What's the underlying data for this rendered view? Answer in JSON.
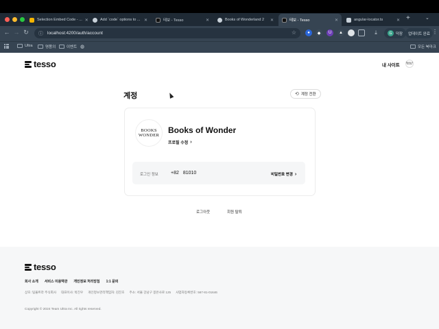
{
  "browser": {
    "tabs": [
      {
        "title": "Selection Embed Code - ..."
      },
      {
        "title": "Add `code` options to ..."
      },
      {
        "title": "테보 - Tesso"
      },
      {
        "title": "Books of Wonderland 2"
      },
      {
        "title": "테보 - Tesso"
      },
      {
        "title": "angular-locator.ts"
      }
    ],
    "active_tab": 4,
    "url": "localhost:4200/auth/account",
    "profile_label": "덕장",
    "update_label": "업데이트 완료",
    "bookmarks": [
      "Ultra",
      "명품의",
      "이벤트"
    ],
    "all_bookmarks": "모든 북마크",
    "colors": {
      "tabstrip": "#1f2a35",
      "toolbar": "#364452"
    }
  },
  "site": {
    "logo_text": "tesso",
    "header": {
      "my_sites": "내 사이트",
      "avatar_text": "Books of Wonder"
    },
    "account": {
      "title": "계정",
      "switch_label": "계정 전환",
      "site_logo_line1": "BOOKS",
      "site_logo_line2": "WONDER",
      "site_name": "Books of Wonder",
      "edit_profile": "프로필 수정",
      "login_label": "로그인 정보",
      "phone_code": "+82",
      "phone_number": "81010",
      "change_password": "비밀번호 변경"
    },
    "actions": {
      "logout": "로그아웃",
      "withdraw": "회원 탈퇴"
    },
    "footer": {
      "links": [
        "회사 소개",
        "서비스 이용약관",
        "개인정보 처리방침",
        "1:1 문의"
      ],
      "info": [
        "상호: 팀울트라 주식회사",
        "대표이사: 박진우",
        "개인정보관리책임자: 김진호",
        "주소: 서울 강남구 봉은사로 125",
        "사업자등록번호: 567-81-01646"
      ],
      "copyright": "Copyright © 2024 Team Ultra Inc. All rights reserved."
    }
  }
}
